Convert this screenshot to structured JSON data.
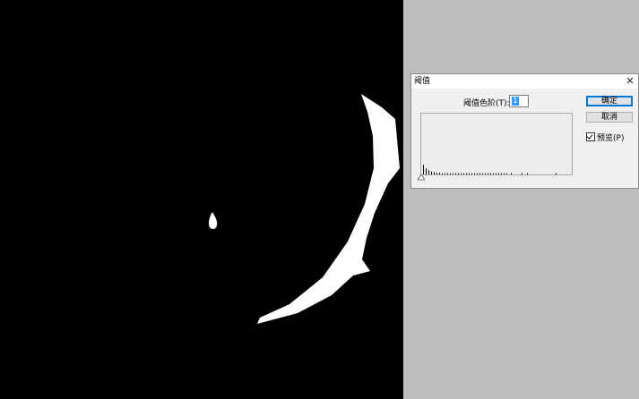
{
  "dialog": {
    "title": "阈值",
    "close_glyph": "✕",
    "threshold_label": "阈值色阶(T):",
    "threshold_value": "1",
    "ok_label": "确定",
    "cancel_label": "取消",
    "preview_label": "预览(P)",
    "preview_checked": true
  },
  "histogram_data": {
    "type": "bar",
    "values": [
      0.16,
      0.1,
      0.07,
      0.05,
      0.04,
      0.03,
      0.03,
      0.02,
      0.02,
      0.02,
      0.02,
      0.02,
      0.02,
      0.02,
      0.02,
      0.02,
      0.02,
      0.02,
      0.02,
      0.02,
      0.02,
      0.02,
      0.02,
      0.02,
      0.02,
      0.02,
      0.02,
      0.02,
      0.02,
      0.02,
      0.02,
      0.02
    ]
  },
  "colors": {
    "canvas": "#000000",
    "shape": "#ffffff",
    "workspace": "#bdbdbd",
    "selection": "#3399ff",
    "ok_border": "#0078d7"
  }
}
